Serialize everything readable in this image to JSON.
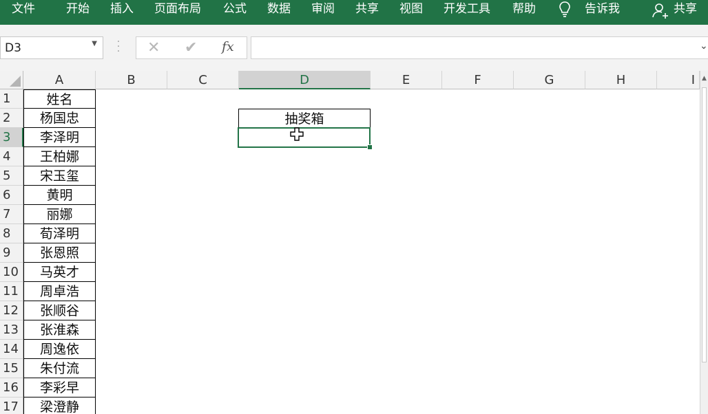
{
  "ribbon": {
    "tabs": [
      "文件",
      "开始",
      "插入",
      "页面布局",
      "公式",
      "数据",
      "审阅",
      "共享",
      "视图",
      "开发工具",
      "帮助"
    ],
    "tell_me": "告诉我",
    "share": "共享"
  },
  "formula_bar": {
    "name_box": "D3",
    "cancel_glyph": "✕",
    "enter_glyph": "✔",
    "fx_label": "fx",
    "content": ""
  },
  "columns": [
    "A",
    "B",
    "C",
    "D",
    "E",
    "F",
    "G",
    "H",
    "I"
  ],
  "selected_column": "D",
  "rows": [
    "1",
    "2",
    "3",
    "4",
    "5",
    "6",
    "7",
    "8",
    "9",
    "10",
    "11",
    "12",
    "13",
    "14",
    "15",
    "16",
    "17"
  ],
  "selected_row": "3",
  "column_a": [
    "姓名",
    "杨国忠",
    "李泽明",
    "王柏娜",
    "宋玉玺",
    "黄明",
    "丽娜",
    "荀泽明",
    "张恩照",
    "马英才",
    "周卓浩",
    "张顺谷",
    "张淮森",
    "周逸依",
    "朱付流",
    "李彩早",
    "梁澄静"
  ],
  "cells": {
    "D2": "抽奖箱",
    "D3": ""
  },
  "colors": {
    "accent": "#217346"
  }
}
